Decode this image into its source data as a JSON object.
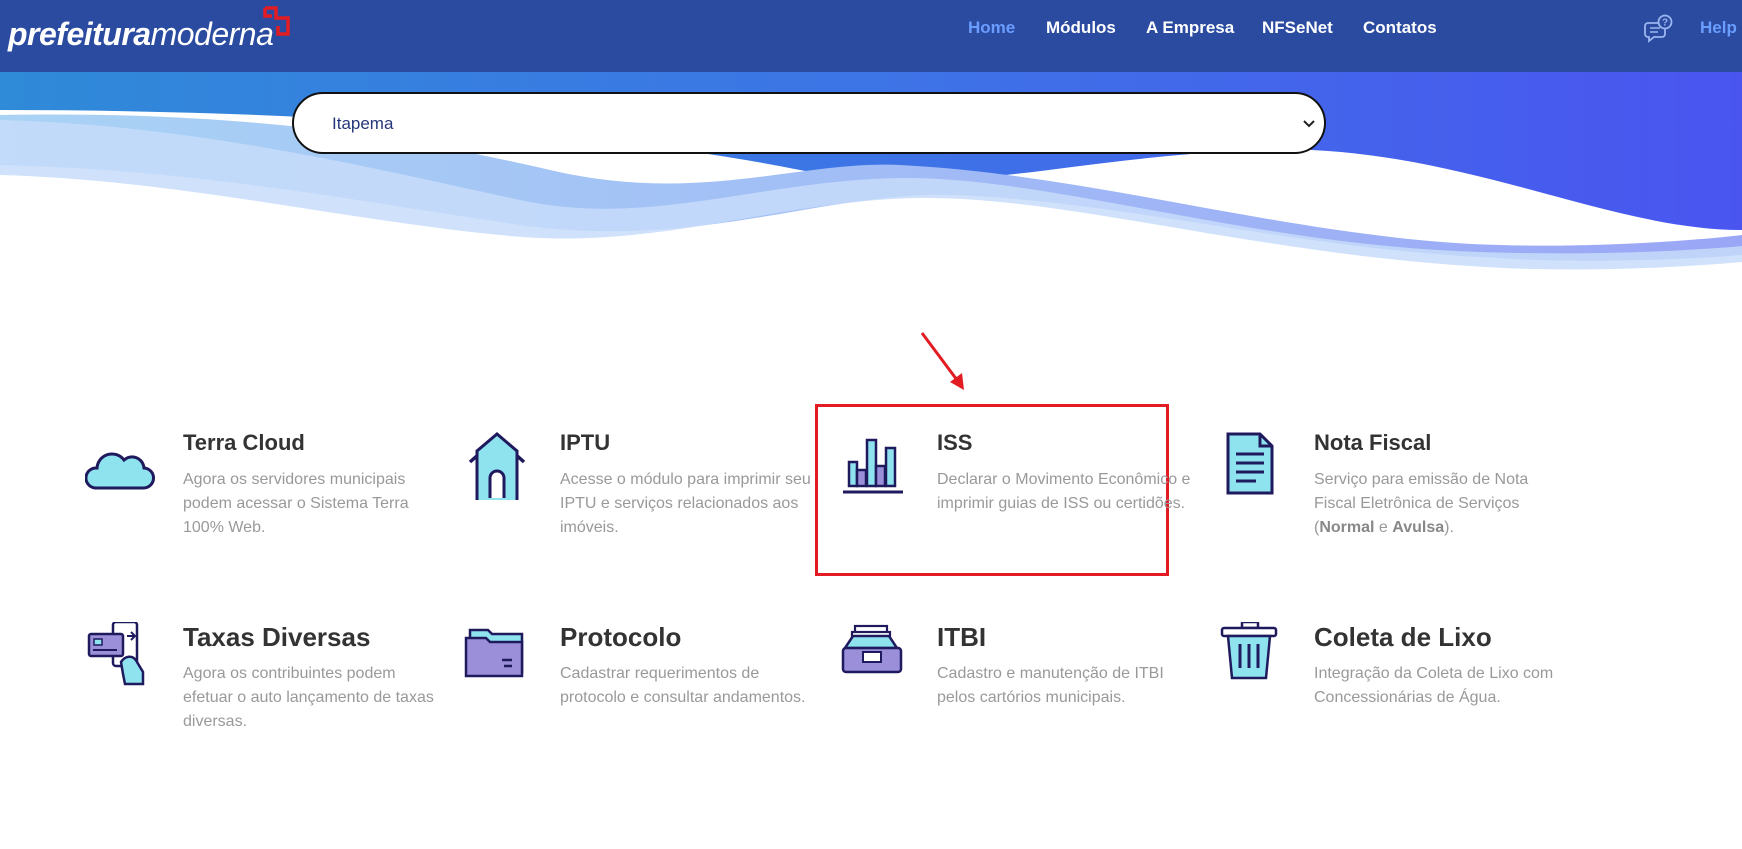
{
  "brand": {
    "bold": "prefeitura",
    "light": "moderna"
  },
  "nav": {
    "items": [
      "Home",
      "Módulos",
      "A Empresa",
      "NFSeNet",
      "Contatos"
    ],
    "active": "Home",
    "help_label": "Help"
  },
  "municipality_select": {
    "value": "Itapema"
  },
  "modules": [
    {
      "title": "Terra Cloud",
      "icon": "cloud-icon",
      "desc": "Agora os servidores municipais podem acessar o Sistema Terra 100% Web."
    },
    {
      "title": "IPTU",
      "icon": "house-icon",
      "desc": "Acesse o módulo para imprimir seu IPTU e serviços relacionados aos imóveis."
    },
    {
      "title": "ISS",
      "icon": "bar-chart-icon",
      "desc": "Declarar o Movimento Econômico e imprimir guias de ISS ou certidões."
    },
    {
      "title": "Nota Fiscal",
      "icon": "document-icon",
      "desc_pre": "Serviço para emissão de Nota Fiscal Eletrônica de Serviços (",
      "desc_b1": "Normal",
      "desc_mid": " e ",
      "desc_b2": "Avulsa",
      "desc_post": ")."
    },
    {
      "title": "Taxas Diversas",
      "icon": "card-payment-icon",
      "desc": "Agora os contribuintes podem efetuar o auto lançamento de taxas diversas."
    },
    {
      "title": "Protocolo",
      "icon": "folder-icon",
      "desc": "Cadastrar requerimentos de protocolo e consultar andamentos."
    },
    {
      "title": "ITBI",
      "icon": "inbox-tray-icon",
      "desc": "Cadastro e manutenção de ITBI pelos cartórios municipais."
    },
    {
      "title": "Coleta de Lixo",
      "icon": "trash-can-icon",
      "desc": "Integração da Coleta de Lixo com Concessionárias de Água."
    }
  ],
  "colors": {
    "topbar": "#2a4ba0",
    "nav_active": "#6b9dff",
    "highlight": "#e21c22",
    "icon_stroke": "#1f1a5e",
    "icon_fill": "#8ee3ef",
    "icon_fill_alt": "#9a8fd8"
  }
}
